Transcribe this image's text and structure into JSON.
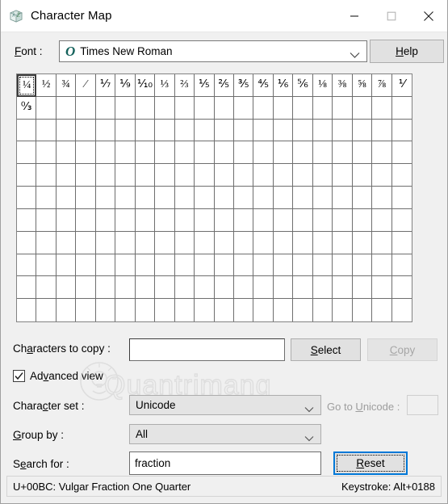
{
  "window": {
    "title": "Character Map",
    "icon": "character-map-icon",
    "controls": {
      "minimize": "minimize-icon",
      "maximize": "maximize-icon",
      "close": "close-icon"
    }
  },
  "font_row": {
    "label": "Font :",
    "label_accel": "F",
    "selected_font": "Times New Roman",
    "font_type_icon": "O",
    "dropdown_icon": "chevron-down-icon",
    "help_label": "Help",
    "help_accel": "H"
  },
  "grid": {
    "columns": 20,
    "rows": 11,
    "selected_index": 0,
    "characters": [
      "¼",
      "½",
      "¾",
      "⁄",
      "⅐",
      "⅑",
      "⅒",
      "⅓",
      "⅔",
      "⅕",
      "⅖",
      "⅗",
      "⅘",
      "⅙",
      "⅚",
      "⅛",
      "⅜",
      "⅝",
      "⅞",
      "⅟",
      "↉"
    ]
  },
  "copy_row": {
    "label": "Characters to copy :",
    "label_accel": "a",
    "input_value": "",
    "select_label": "Select",
    "select_accel": "S",
    "copy_label": "Copy",
    "copy_accel": "C",
    "copy_enabled": false
  },
  "advanced": {
    "label": "Advanced view",
    "label_accel": "v",
    "checked": true,
    "check_icon": "checkmark-icon"
  },
  "watermark": {
    "text": "Quantrimang",
    "logo": "lightbulb-icon"
  },
  "charset_row": {
    "label": "Character set :",
    "label_accel": "c",
    "value": "Unicode",
    "dropdown_icon": "chevron-down-icon",
    "goto_label": "Go to Unicode :",
    "goto_accel": "U",
    "goto_value": "",
    "goto_enabled": false
  },
  "groupby_row": {
    "label": "Group by :",
    "label_accel": "G",
    "value": "All",
    "dropdown_icon": "chevron-down-icon"
  },
  "search_row": {
    "label": "Search for :",
    "label_accel": "e",
    "value": "fraction",
    "reset_label": "Reset",
    "reset_accel": "R",
    "reset_focused": true
  },
  "statusbar": {
    "character_info": "U+00BC: Vulgar Fraction One Quarter",
    "keystroke": "Keystroke: Alt+0188"
  },
  "colors": {
    "window_bg": "#f0f0f0",
    "titlebar_bg": "#ffffff",
    "button_face": "#e1e1e1",
    "focus_blue": "#0078d7",
    "disabled_text": "#a6a6a6",
    "grid_line": "#6e6e6e",
    "ot_icon": "#15625c"
  }
}
